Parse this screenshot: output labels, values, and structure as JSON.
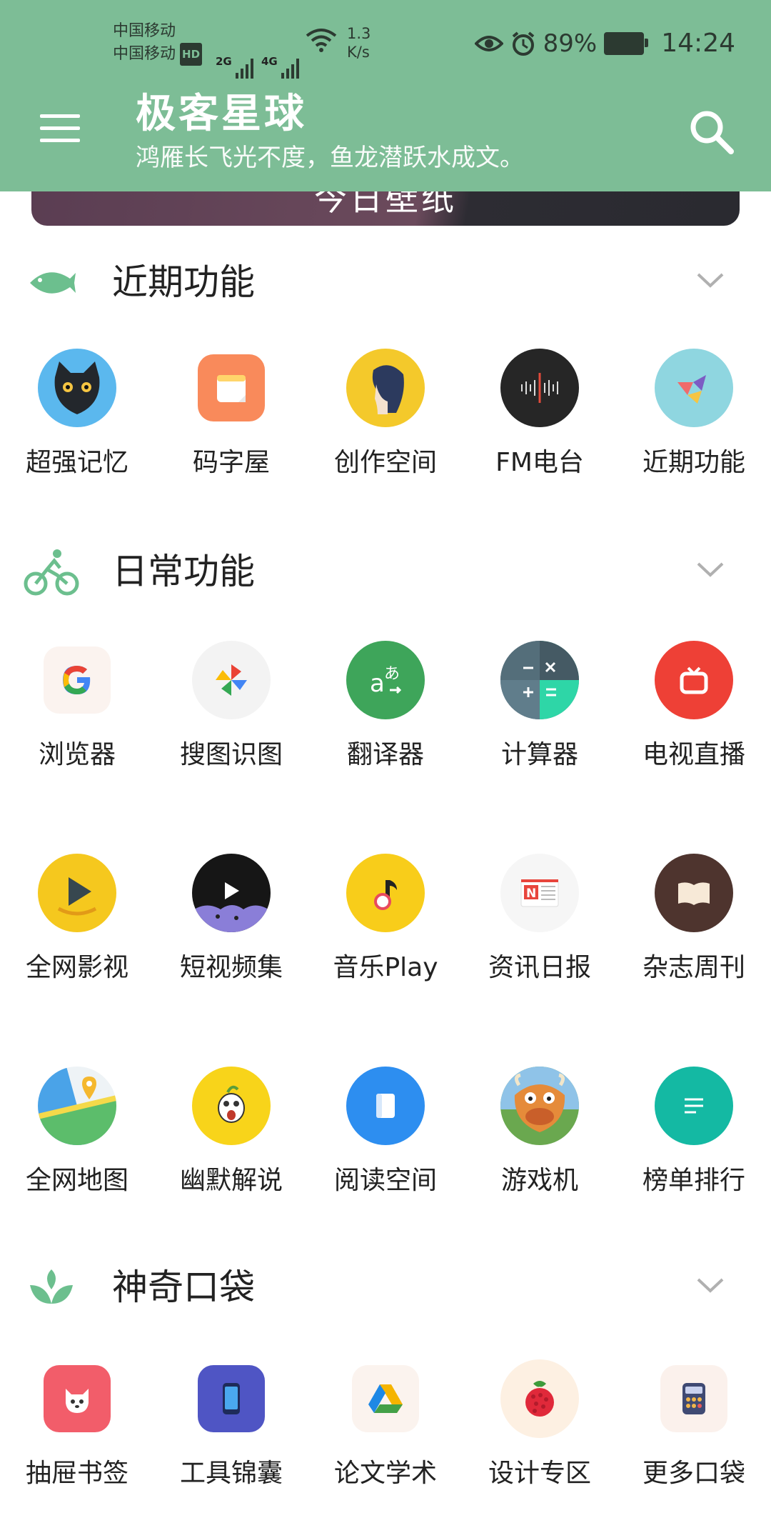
{
  "status_bar": {
    "carrier1": "中国移动",
    "carrier2": "中国移动",
    "hd": "HD",
    "net1": "2G",
    "net2": "4G",
    "speed_value": "1.3",
    "speed_unit": "K/s",
    "battery": "89%",
    "time": "14:24"
  },
  "header": {
    "title": "极客星球",
    "subtitle": "鸿雁长飞光不度，鱼龙潜跃水成文。"
  },
  "banner": {
    "text": "今日壁纸"
  },
  "sections": {
    "recent": {
      "title": "近期功能",
      "items": [
        {
          "label": "超强记忆",
          "icon": "black-cat-icon"
        },
        {
          "label": "码字屋",
          "icon": "notepad-icon"
        },
        {
          "label": "创作空间",
          "icon": "girl-portrait-icon"
        },
        {
          "label": "FM电台",
          "icon": "sound-wave-icon"
        },
        {
          "label": "近期功能",
          "icon": "origami-bird-icon"
        }
      ]
    },
    "daily": {
      "title": "日常功能",
      "rows": [
        [
          {
            "label": "浏览器",
            "icon": "google-icon"
          },
          {
            "label": "搜图识图",
            "icon": "pinwheel-icon"
          },
          {
            "label": "翻译器",
            "icon": "translate-icon"
          },
          {
            "label": "计算器",
            "icon": "calculator-icon"
          },
          {
            "label": "电视直播",
            "icon": "tv-icon"
          }
        ],
        [
          {
            "label": "全网影视",
            "icon": "play-icon"
          },
          {
            "label": "短视频集",
            "icon": "short-video-icon"
          },
          {
            "label": "音乐Play",
            "icon": "music-note-icon"
          },
          {
            "label": "资讯日报",
            "icon": "news-icon"
          },
          {
            "label": "杂志周刊",
            "icon": "open-book-icon"
          }
        ],
        [
          {
            "label": "全网地图",
            "icon": "map-pin-icon"
          },
          {
            "label": "幽默解说",
            "icon": "funny-face-icon"
          },
          {
            "label": "阅读空间",
            "icon": "reader-icon"
          },
          {
            "label": "游戏机",
            "icon": "cow-game-icon"
          },
          {
            "label": "榜单排行",
            "icon": "list-icon"
          }
        ]
      ]
    },
    "pocket": {
      "title": "神奇口袋",
      "items": [
        {
          "label": "抽屉书签",
          "icon": "dog-icon"
        },
        {
          "label": "工具锦囊",
          "icon": "phone-icon"
        },
        {
          "label": "论文学术",
          "icon": "drive-triangle-icon"
        },
        {
          "label": "设计专区",
          "icon": "raspberry-icon"
        },
        {
          "label": "更多口袋",
          "icon": "calculator-pad-icon"
        }
      ]
    }
  },
  "colors": {
    "header_bg": "#7dbd96",
    "accent_green": "#6cbf8e"
  }
}
